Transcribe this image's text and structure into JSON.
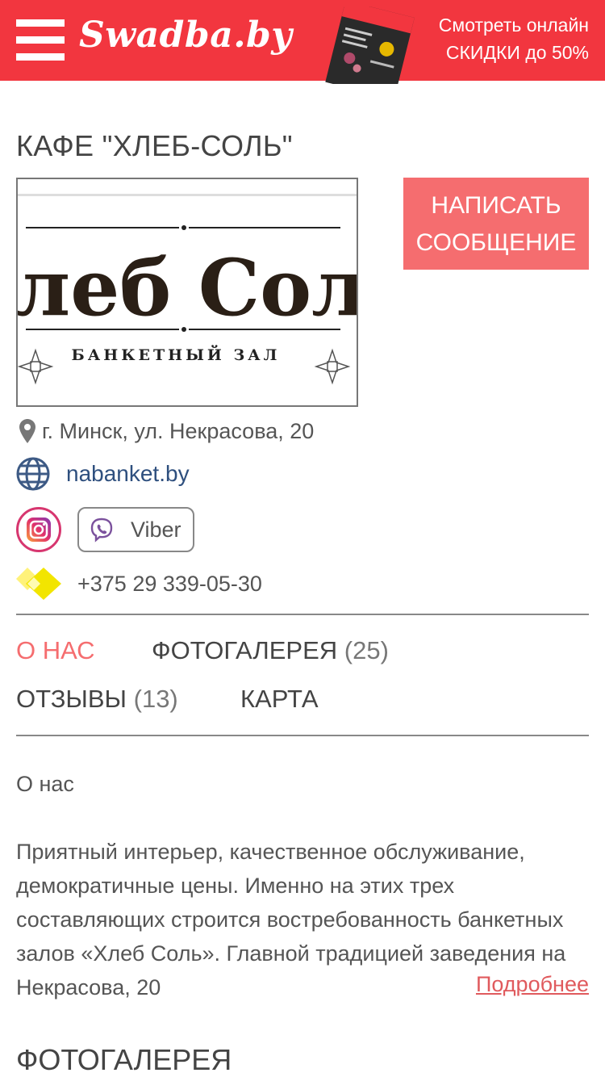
{
  "header": {
    "logo": "Swadba.by",
    "promo_line1": "Смотреть онлайн",
    "promo_line2": "СКИДКИ до 50%",
    "bg_color": "#f2363f"
  },
  "venue": {
    "title": "КАФЕ \"ХЛЕБ-СОЛЬ\"",
    "logo_main": "Хлеб Соль",
    "logo_sub": "БАНКЕТНЫЙ ЗАЛ",
    "message_button_line1": "НАПИСАТЬ",
    "message_button_line2": "СООБЩЕНИЕ",
    "address": "г. Минск, ул. Некрасова, 20",
    "website": "nabanket.by",
    "viber_label": "Viber",
    "phone": "+375 29 339-05-30"
  },
  "tabs": [
    {
      "label": "О НАС",
      "count": ""
    },
    {
      "label": "ФОТОГАЛЕРЕЯ",
      "count": "(25)"
    },
    {
      "label": "ОТЗЫВЫ",
      "count": "(13)"
    },
    {
      "label": "КАРТА",
      "count": ""
    }
  ],
  "about": {
    "heading": "О нас",
    "text": "Приятный интерьер, качественное обслуживание, демократичные цены. Именно на этих трех составляющих строится востребованность банкетных залов «Хлеб Соль». Главной традицией заведения на Некрасова, 20",
    "more_link": "Подробнее"
  },
  "gallery": {
    "heading": "ФОТОГАЛЕРЕЯ"
  },
  "icons": {
    "menu": "hamburger-menu-icon",
    "address": "map-pin-icon",
    "website": "globe-icon",
    "instagram": "instagram-icon",
    "viber": "viber-icon",
    "phone": "velcom-operator-icon"
  },
  "colors": {
    "accent": "#f56d6f",
    "link": "#2e4f7e",
    "instagram": "#d7366f",
    "viber": "#7b519d",
    "operator": "#f2e500"
  }
}
